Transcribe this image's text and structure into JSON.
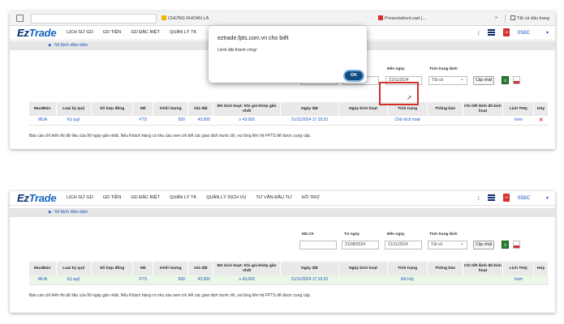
{
  "browser": {
    "tab_chungkhoan": "CHỨNG KHOÁN LÀ",
    "tab_presentation": "PresentationLoad |...",
    "overflow": "»",
    "bookmarks_label": "Tất cả dấu trang"
  },
  "app": {
    "logo_ez": "Ez",
    "logo_trade": "Trade",
    "menu_top": [
      "LỊCH SỬ GD",
      "GD TIỀN",
      "GD ĐẶC BIỆT",
      "QUẢN LÝ TK"
    ],
    "menu_full": [
      "LỊCH SỬ GD",
      "GD TIỀN",
      "GD ĐẶC BIỆT",
      "QUẢN LÝ TK",
      "QUẢN LÝ DỊCH VỤ",
      "TƯ VẤN ĐẦU TƯ",
      "HỖ TRỢ"
    ],
    "account": "058C",
    "accent": "#0b2a6b",
    "link_color": "#1a56c4"
  },
  "filter": {
    "section_link": "Sổ lệnh điều kiện",
    "mack_label": "Mã CK",
    "from_label": "Từ ngày",
    "from_value": "21/08/2024",
    "to_label": "Đến ngày",
    "to_value": "21/11/2024",
    "status_label": "Tình trạng lệnh",
    "status_value": "Tất cả",
    "update_button": "Cập nhật"
  },
  "table": {
    "headers": [
      "Mua/Bán",
      "Loại ký quỹ",
      "Số hợp đồng",
      "Mã",
      "Khối lượng",
      "Giá đặt",
      "ĐK kích hoạt: Khi giá khớp gần nhất",
      "Ngày đặt",
      "Ngày kích hoạt",
      "Tình trạng",
      "Thông báo",
      "Chi tiết lệnh đã kích hoạt",
      "Lịch THQ",
      "Hủy"
    ],
    "row_before": {
      "side": "MUA",
      "margin": "Ký quỹ",
      "contract": "",
      "symbol": "FTS",
      "qty": "500",
      "price": "43,500",
      "condition": "≥ 43,000",
      "order_date": "21/11/2024 17:15:52",
      "activate_date": "",
      "status": "Chờ kích hoạt",
      "notice": "",
      "detail": "",
      "schedule": "Xem"
    },
    "row_after": {
      "side": "MUA",
      "margin": "Ký quỹ",
      "contract": "",
      "symbol": "FTS",
      "qty": "500",
      "price": "43,500",
      "condition": "≥ 43,000",
      "order_date": "21/11/2024 17:15:52",
      "activate_date": "",
      "status": "Đã hủy",
      "notice": "",
      "detail": "",
      "schedule": "Xem"
    }
  },
  "note": "Báo cáo chỉ hiển thị dữ liệu của 90 ngày gần nhất. Nếu Khách hàng có nhu cầu xem chi tiết các giao dịch trước đó, vui lòng liên hệ FPTS để được cung cấp.",
  "dialog": {
    "title": "eztrade.fpts.com.vn cho biết",
    "message": "Lệnh đặt thành công!",
    "ok": "OK"
  },
  "icons": [
    "grid-icon",
    "sort-icon",
    "menu-icon",
    "bell-icon",
    "excel-icon",
    "pdf-icon",
    "delete-icon",
    "cursor-icon"
  ]
}
